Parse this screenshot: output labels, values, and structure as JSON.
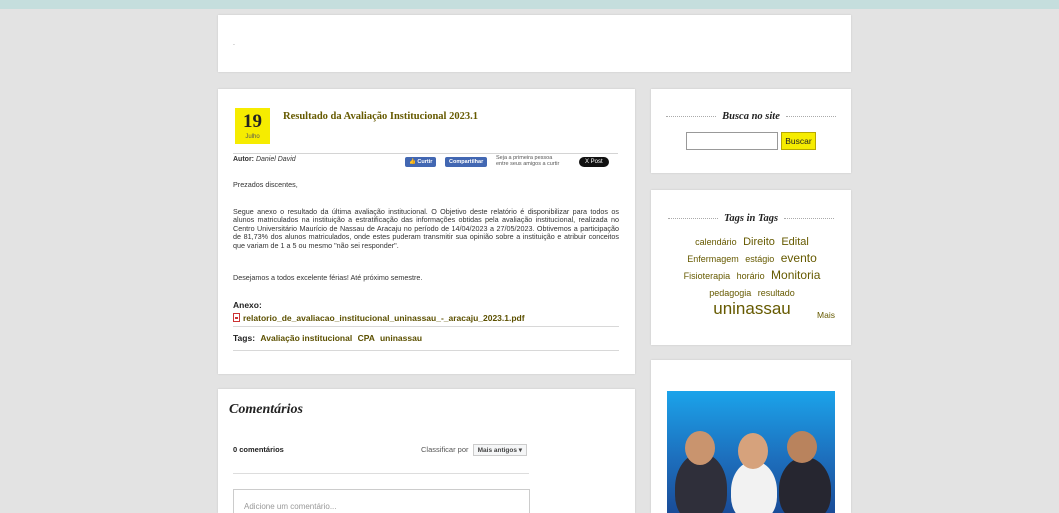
{
  "header": {
    "text": "."
  },
  "article": {
    "day": "19",
    "month": "Julho",
    "title": "Resultado da Avaliação Institucional 2023.1",
    "author_label": "Autor:",
    "author_name": "Daniel David",
    "fb_like": "Curtir",
    "fb_share": "Compartilhar",
    "fb_note": "Seja a primeira pessoa entre seus amigos a curtir isso.",
    "x_post": "X Post",
    "greeting": "Prezados discentes,",
    "body": "Segue anexo o resultado da última avaliação institucional. O Objetivo deste relatório é disponibilizar para todos os alunos matriculados na instituição a estratificação das informações obtidas pela avaliação institucional, realizada no Centro Universitário Maurício de Nassau de Aracaju no período de 14/04/2023 a 27/05/2023. Obtivemos a participação de 81,73% dos alunos matriculados, onde estes puderam transmitir sua opinião sobre a instituição e atribuir conceitos que variam de 1 a 5 ou mesmo \"não sei responder\".",
    "closing": "Desejamos a todos excelente férias! Até próximo semestre.",
    "attachment_label": "Anexo:",
    "attachment_file": "relatorio_de_avaliacao_institucional_uninassau_-_aracaju_2023.1.pdf",
    "tags_label": "Tags:",
    "tags": [
      "Avaliação institucional",
      "CPA",
      "uninassau"
    ]
  },
  "comments": {
    "title": "Comentários",
    "count": "0 comentários",
    "sort_label": "Classificar por",
    "sort_value": "Mais antigos ▾",
    "placeholder": "Adicione um comentário..."
  },
  "sidebar": {
    "search_title": "Busca no site",
    "search_button": "Buscar",
    "tags_title": "Tags in Tags",
    "tag_cloud": [
      {
        "label": "calendário",
        "size": 9
      },
      {
        "label": "Direito",
        "size": 11
      },
      {
        "label": "Edital",
        "size": 11
      },
      {
        "label": "Enfermagem",
        "size": 9
      },
      {
        "label": "estágio",
        "size": 9
      },
      {
        "label": "evento",
        "size": 12
      },
      {
        "label": "Fisioterapia",
        "size": 9
      },
      {
        "label": "horário",
        "size": 9
      },
      {
        "label": "Monitoria",
        "size": 12
      },
      {
        "label": "pedagogia",
        "size": 9
      },
      {
        "label": "resultado",
        "size": 9
      },
      {
        "label": "uninassau",
        "size": 17
      }
    ],
    "more": "Mais"
  },
  "colors": {
    "accent_yellow": "#f6ec00",
    "link_olive": "#665a00",
    "background": "#e3e3e3",
    "topbar": "#c5dedd"
  }
}
